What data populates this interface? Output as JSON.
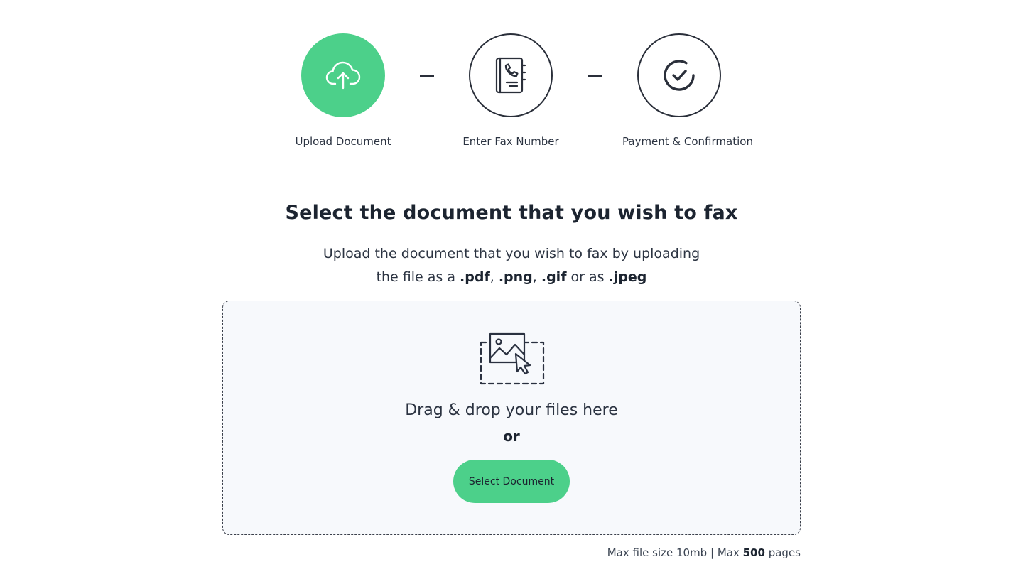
{
  "stepper": {
    "steps": [
      {
        "label": "Upload Document",
        "icon": "cloud-upload-icon",
        "state": "active"
      },
      {
        "label": "Enter Fax Number",
        "icon": "phone-book-icon",
        "state": "pending"
      },
      {
        "label": "Payment & Confirmation",
        "icon": "check-circle-icon",
        "state": "pending"
      }
    ]
  },
  "main": {
    "title": "Select the document that you wish to fax",
    "subtitle_line1": "Upload the document that you wish to fax by uploading",
    "subtitle_line2_prefix": "the file as a",
    "formats": [
      ".pdf",
      ".png",
      ".gif",
      ".jpeg"
    ],
    "subtitle_sep_comma": ",",
    "subtitle_or": "or as"
  },
  "dropzone": {
    "icon": "image-drop-icon",
    "drag_text": "Drag & drop your files here",
    "or_text": "or",
    "button_label": "Select Document"
  },
  "limits": {
    "size_text": "Max file size 10mb",
    "separator": "|",
    "pages_prefix": "Max",
    "pages_count": "500",
    "pages_suffix": "pages"
  },
  "colors": {
    "accent": "#4cd08a",
    "dropzone_bg": "#f7f9fc",
    "text_dark": "#1c2430"
  }
}
